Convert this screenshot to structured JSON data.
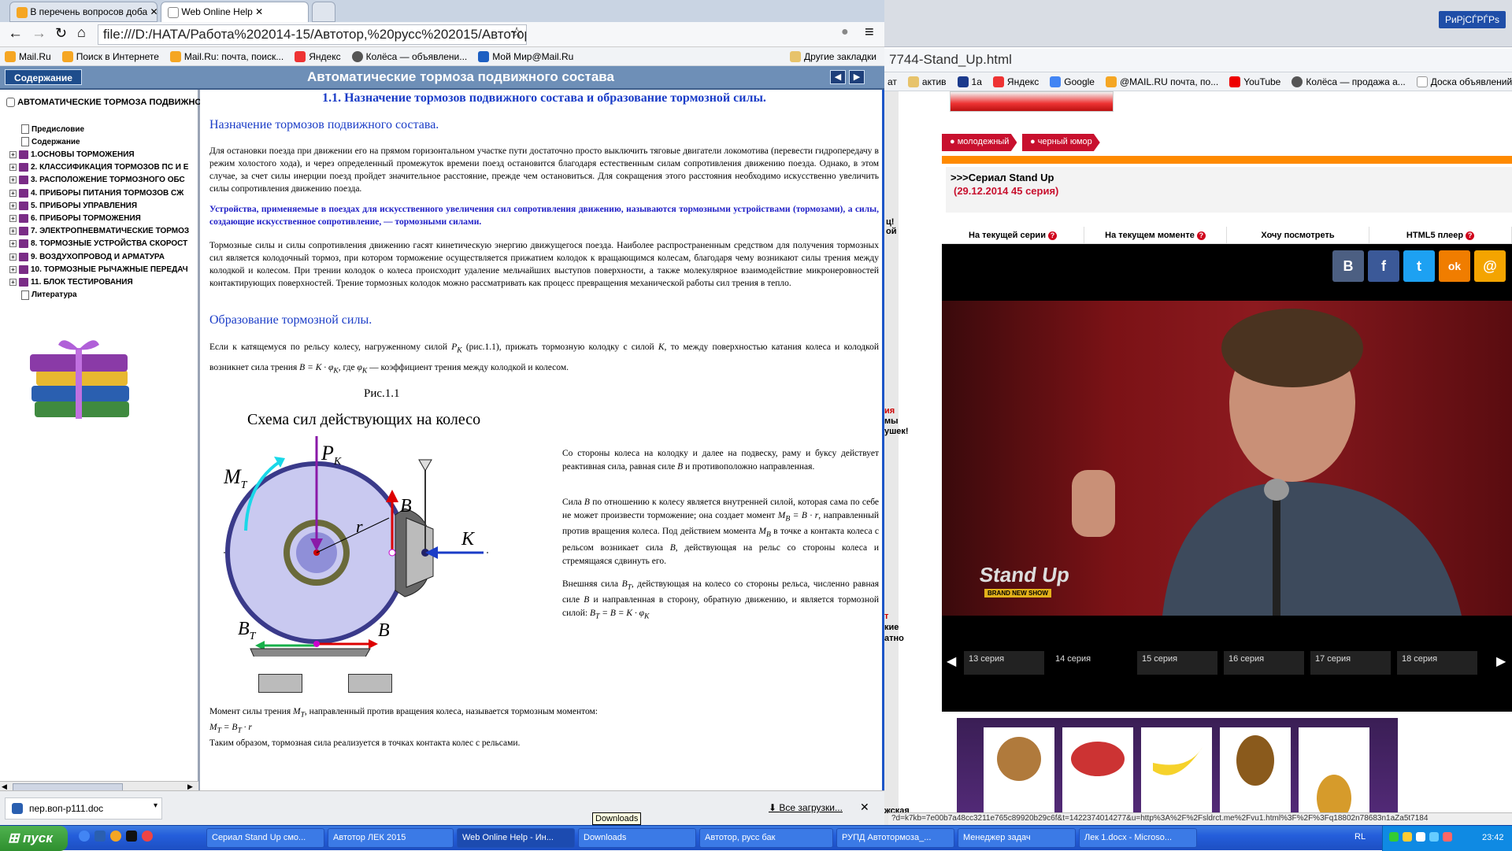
{
  "left_browser": {
    "tabs": [
      {
        "label": "В перечень вопросов доба"
      },
      {
        "label": "Web Online Help"
      }
    ],
    "address": "file:///D:/НАТА/Работа%202014-15/Автотор,%20русс%202015/Автотор%2",
    "bookmarks": [
      "Mail.Ru",
      "Поиск в Интернете",
      "Mail.Ru: почта, поиск...",
      "Яндекс",
      "Колёса — объявлени...",
      "Мой Мир@Mail.Ru"
    ],
    "other_bookmarks": "Другие закладки"
  },
  "help": {
    "contents_button": "Содержание",
    "header_title": "Автоматические тормоза подвижного состава",
    "toc_title": "АВТОМАТИЧЕСКИЕ ТОРМОЗА ПОДВИЖНО",
    "toc": [
      {
        "label": "Предисловие",
        "kind": "page"
      },
      {
        "label": "Содержание",
        "kind": "page"
      },
      {
        "label": "1.ОСНОВЫ ТОРМОЖЕНИЯ",
        "kind": "book"
      },
      {
        "label": "2. КЛАССИФИКАЦИЯ ТОРМОЗОВ ПС И Е",
        "kind": "book"
      },
      {
        "label": "3. РАСПОЛОЖЕНИЕ ТОРМОЗНОГО ОБС",
        "kind": "book"
      },
      {
        "label": "4. ПРИБОРЫ ПИТАНИЯ ТОРМОЗОВ СЖ",
        "kind": "book"
      },
      {
        "label": "5. ПРИБОРЫ УПРАВЛЕНИЯ",
        "kind": "book"
      },
      {
        "label": "6. ПРИБОРЫ ТОРМОЖЕНИЯ",
        "kind": "book"
      },
      {
        "label": "7. ЭЛЕКТРОПНЕВМАТИЧЕСКИЕ ТОРМОЗ",
        "kind": "book"
      },
      {
        "label": "8. ТОРМОЗНЫЕ УСТРОЙСТВА СКОРОСТ",
        "kind": "book"
      },
      {
        "label": "9. ВОЗДУХОПРОВОД И АРМАТУРА",
        "kind": "book"
      },
      {
        "label": "10. ТОРМОЗНЫЕ РЫЧАЖНЫЕ ПЕРЕДАЧ",
        "kind": "book"
      },
      {
        "label": "11. БЛОК ТЕСТИРОВАНИЯ",
        "kind": "book"
      },
      {
        "label": "Литература",
        "kind": "page"
      }
    ],
    "doc": {
      "h1": "1.1. Назначение тормозов подвижного состава и образование тормозной силы.",
      "h2a": "Назначение тормозов подвижного состава.",
      "p1": "Для остановки поезда при движении его на прямом горизонтальном участке пути достаточно просто выключить тяговые двигатели локомотива (перевести гидропередачу в режим холостого хода), и через определенный промежуток времени поезд остановится благодаря естественным силам сопротивления движению поезда. Однако, в этом случае, за счет силы инерции поезд пройдет значительное расстояние, прежде чем остановиться. Для сокращения этого расстояния необходимо искусственно увеличить силы сопротивления движению поезда.",
      "p2": "Устройства, применяемые в поездах для искусственного увеличения сил сопротивления движению, называются тормозными устройствами (тормозами), а силы, создающие искусственное сопротивление, — тормозными силами.",
      "p3": "Тормозные силы и силы сопротивления движению гасят кинетическую энергию движущегося поезда. Наиболее распространенным средством для получения тормозных сил является колодочный тормоз, при котором торможение осуществляется прижатием колодок к вращающимся колесам, благодаря чему возникают силы трения между колодкой и колесом. При трении колодок о колеса происходит удаление мельчайших выступов поверхности, а также молекулярное взаимодействие микронеровностей контактирующих поверхностей. Трение тормозных колодок можно рассматривать как процесс превращения механической работы сил трения в тепло.",
      "h2b": "Образование тормозной силы.",
      "p4a": "Если к катящемуся по рельсу колесу, нагруженному силой",
      "p4b": "(рис.1.1), прижать тормозную колодку с силой",
      "p4c": ", то между поверхностью катания колеса и колодкой возникнет сила трения",
      "p4d": ", где",
      "p4e": "— коэффициент трения между колодкой и колесом.",
      "fig_caption": "Рис.1.1",
      "fig_title": "Схема сил действующих на колесо",
      "r1": "Со стороны колеса на колодку и далее на подвеску, раму и буксу действует реактивная сила, равная силе",
      "r1b": "и противоположно направленная.",
      "r2a": "Сила",
      "r2b": "по отношению к колесу является внутренней силой, которая сама по себе не может произвести торможение; она создает момент",
      "r2c": ", направленный против вращения колеса. Под действием момента",
      "r2d": "в точке а контакта колеса с рельсом возникает сила",
      "r2e": ", действующая на рельс со стороны колеса и стремящаяся сдвинуть его.",
      "r3a": "Внешняя сила",
      "r3b": ", действующая на колесо со стороны рельса, численно равная силе",
      "r3c": "и направленная в сторону, обратную движению, и является тормозной силой:",
      "m1": "Момент силы трения",
      "m1b": ", направленный против вращения колеса, называется тормозным моментом:",
      "m2": "Таким образом, тормозная сила реализуется в точках контакта колес с рельсами."
    },
    "formulas": {
      "PK": "P",
      "PKsub": "K",
      "K": "K",
      "B": "B",
      "Bform": "B = K · φ",
      "Ksub": "K",
      "phi": "φ",
      "MB": "M",
      "MBsub": "B",
      "MBform": "= B · r",
      "MBvar": "M",
      "Bvar": "B",
      "BT": "B",
      "Tsub": "T",
      "BTform": "B",
      "BTrest": "= B = K · φ",
      "MT": "M",
      "MTform": "= B",
      "MTr": "· r"
    },
    "fig_labels": {
      "MT": "M",
      "Tsub": "T",
      "PK": "P",
      "PKsub": "K",
      "B": "B",
      "r": "r",
      "K": "K",
      "BT": "B",
      "BTsub": "T",
      "B2": "B"
    }
  },
  "downloads": {
    "file": "пер.воп-р111.doc",
    "all": "Все загрузки...",
    "tooltip": "Downloads"
  },
  "right_browser": {
    "title": "РиРјСЃРЃРѕ",
    "address": "7744-Stand_Up.html",
    "bookmarks": [
      "ат",
      "актив",
      "1а",
      "Яндекс",
      "Google",
      "@MAIL.RU почта, по...",
      "YouTube",
      "Колёса — продажа а...",
      "Доска объявлений Ol..."
    ],
    "tags": [
      "молодежный",
      "черный юмор"
    ],
    "series_title": ">>>Сериал Stand Up",
    "series_date": "(29.12.2014 45 серия)",
    "video_tabs": [
      "На текущей серии",
      "На текущем моменте",
      "Хочу посмотреть",
      "HTML5 плеер"
    ],
    "social": [
      "В",
      "f",
      "t",
      "ok",
      "@"
    ],
    "episodes": [
      "13 серия",
      "14 серия",
      "15 серия",
      "16 серия",
      "17 серия",
      "18 серия"
    ],
    "logo": "Stand Up",
    "logo_sub": "BRAND NEW SHOW",
    "left_snips": [
      "ц!",
      "ой",
      "ия",
      "мы",
      "ушек!",
      "т",
      "кие",
      "атно",
      "жская"
    ],
    "status_url": "?d=k7kb=7e00b7a48cc3211e765c89920b29c6f&t=1422374014277&u=http%3A%2F%2Fsldrct.me%2Fvu1.html%3F%2F%3Fq18802n78683n1aZa5t7184"
  },
  "taskbar": {
    "start": "пуск",
    "items": [
      "Сериал Stand Up смо...",
      "Автотор ЛЕК 2015",
      "Web Online Help - Ин...",
      "Downloads",
      "Автотор, русс бак",
      "РУПД Автотормоза_...",
      "Менеджер задач",
      "Лек 1.docx - Microso..."
    ],
    "lang": "RL",
    "clock": "23:42"
  }
}
